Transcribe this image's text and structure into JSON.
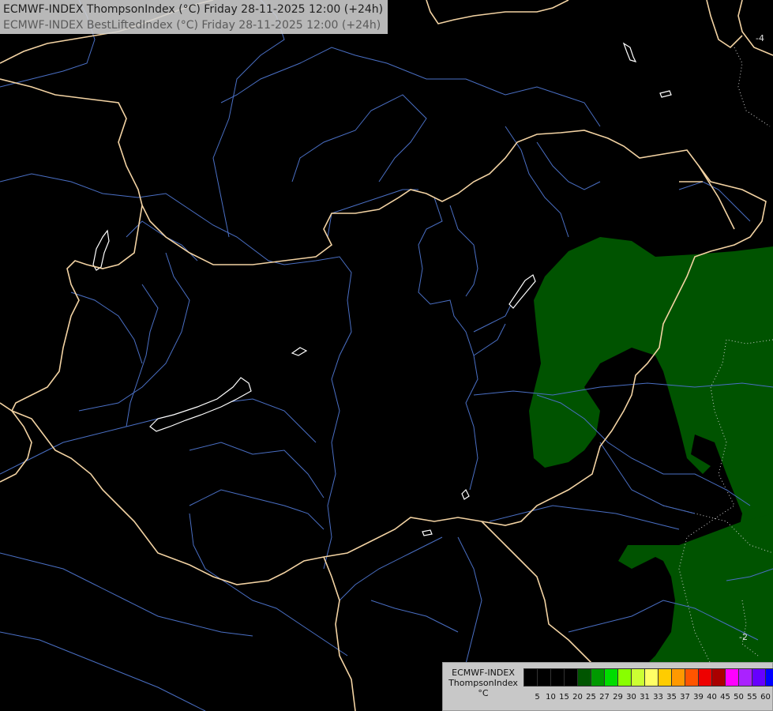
{
  "title": {
    "line1": "ECMWF-INDEX ThompsonIndex (°C) Friday 28-11-2025 12:00 (+24h)",
    "line2": "ECMWF-INDEX BestLiftedIndex (°C) Friday 28-11-2025 12:00 (+24h)"
  },
  "legend": {
    "line1": "ECMWF-INDEX",
    "line2": "ThompsonIndex",
    "unit": "°C",
    "ticks": [
      "5",
      "10",
      "15",
      "20",
      "25",
      "27",
      "29",
      "30",
      "31",
      "33",
      "35",
      "37",
      "39",
      "40",
      "45",
      "50",
      "55",
      "60"
    ],
    "colors": [
      "#000000",
      "#000000",
      "#000000",
      "#000000",
      "#005500",
      "#009900",
      "#00dd00",
      "#88ff00",
      "#ccff33",
      "#ffff66",
      "#ffcc00",
      "#ff9900",
      "#ff5500",
      "#ee0000",
      "#aa0000",
      "#ff00ff",
      "#aa22ff",
      "#6600ff",
      "#0000ff"
    ]
  },
  "contour_labels": {
    "a": "-4",
    "b": "-2"
  },
  "colors": {
    "border": "#f3d3a3",
    "river": "#4a6fc4",
    "shade": "#005300",
    "lake": "#ffffff"
  }
}
